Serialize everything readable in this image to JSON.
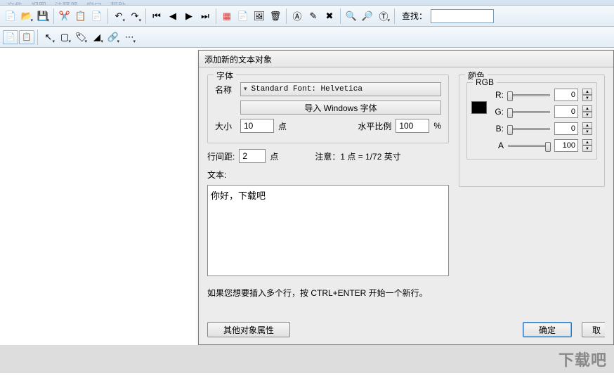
{
  "menu": {
    "items": [
      "文件",
      "视图",
      "注释器",
      "窗口",
      "帮助"
    ]
  },
  "toolbar1": {
    "search_label": "查找："
  },
  "dialog": {
    "title": "添加新的文本对象",
    "font_group": "字体",
    "name_label": "名称",
    "font_name": "Standard Font: Helvetica",
    "import_btn": "导入 Windows 字体",
    "size_label": "大小",
    "size_value": "10",
    "size_unit": "点",
    "hscale_label": "水平比例",
    "hscale_value": "100",
    "hscale_unit": "%",
    "line_spacing_label": "行间距:",
    "line_spacing_value": "2",
    "line_spacing_unit": "点",
    "note_label": "注意：1 点 = 1/72 英寸",
    "text_label": "文本:",
    "text_value": "你好，下载吧",
    "multiline_hint": "如果您想要插入多个行，按 CTRL+ENTER 开始一个新行。",
    "other_props_btn": "其他对象属性",
    "ok_btn": "确定",
    "cancel_btn": "取",
    "color_group": "颜色",
    "rgb_label": "RGB",
    "channels": {
      "r": {
        "label": "R:",
        "value": "0",
        "pos": 0
      },
      "g": {
        "label": "G:",
        "value": "0",
        "pos": 0
      },
      "b": {
        "label": "B:",
        "value": "0",
        "pos": 0
      },
      "a": {
        "label": "A",
        "value": "100",
        "pos": 100
      }
    }
  },
  "watermark": "下载吧"
}
